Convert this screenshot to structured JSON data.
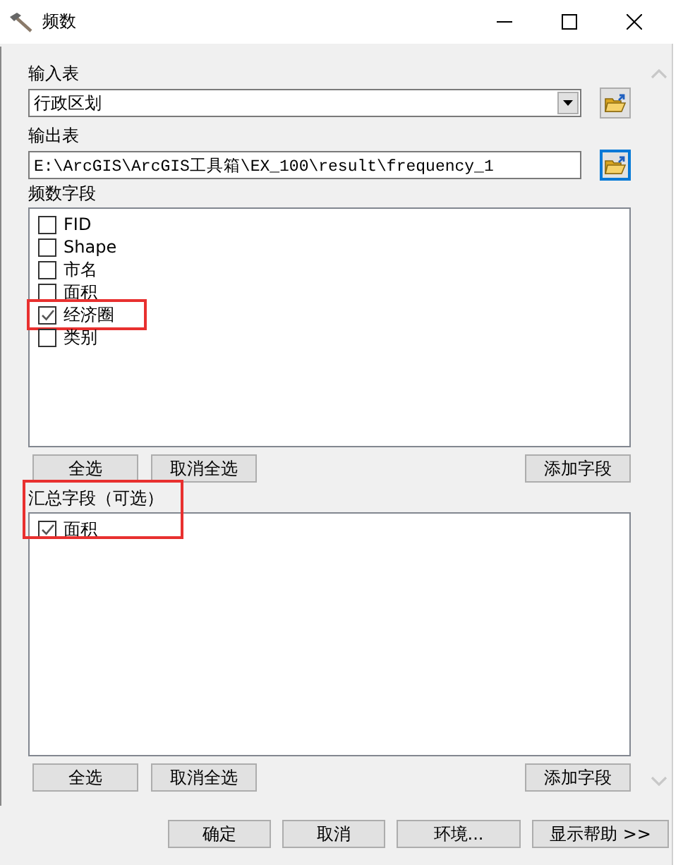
{
  "window": {
    "title": "频数"
  },
  "input_table": {
    "label": "输入表",
    "kind": "dropdown",
    "value": "行政区划",
    "browse_focused": false
  },
  "output_table": {
    "label": "输出表",
    "kind": "text",
    "value": "E:\\ArcGIS\\ArcGIS工具箱\\EX_100\\result\\frequency_1",
    "browse_focused": true
  },
  "frequency_fields": {
    "label": "频数字段",
    "highlighted": false,
    "items": [
      {
        "label": "FID",
        "checked": false,
        "highlighted": false
      },
      {
        "label": "Shape",
        "checked": false,
        "highlighted": false
      },
      {
        "label": "市名",
        "checked": false,
        "highlighted": false
      },
      {
        "label": "面积",
        "checked": false,
        "highlighted": false
      },
      {
        "label": "经济圈",
        "checked": true,
        "highlighted": true
      },
      {
        "label": "类别",
        "checked": false,
        "highlighted": false
      }
    ],
    "buttons": [
      "全选",
      "取消全选",
      "添加字段"
    ]
  },
  "summary_fields": {
    "label": "汇总字段（可选）",
    "highlighted": true,
    "items": [
      {
        "label": "面积",
        "checked": true,
        "highlighted": false
      }
    ],
    "buttons": [
      "全选",
      "取消全选",
      "添加字段"
    ]
  },
  "footer_buttons": [
    "确定",
    "取消",
    "环境...",
    "显示帮助 >>"
  ]
}
